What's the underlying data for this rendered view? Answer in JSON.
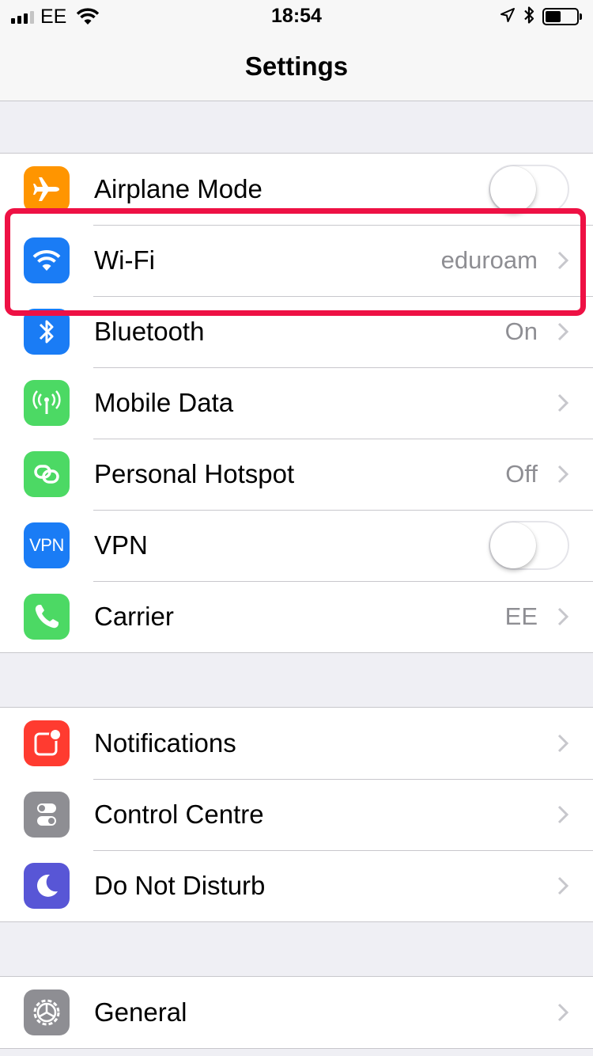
{
  "status_bar": {
    "carrier": "EE",
    "time": "18:54",
    "battery_level": 0.5
  },
  "nav": {
    "title": "Settings"
  },
  "groups": [
    [
      {
        "label": "Airplane Mode",
        "icon": "airplane-icon",
        "color": "#ff9500",
        "accessory": "toggle",
        "on": false
      },
      {
        "label": "Wi-Fi",
        "icon": "wifi-icon",
        "color": "#1a7cf5",
        "accessory": "chevron",
        "value": "eduroam",
        "highlighted": true
      },
      {
        "label": "Bluetooth",
        "icon": "bluetooth-icon",
        "color": "#1a7cf5",
        "accessory": "chevron",
        "value": "On"
      },
      {
        "label": "Mobile Data",
        "icon": "antenna-icon",
        "color": "#4cd964",
        "accessory": "chevron"
      },
      {
        "label": "Personal Hotspot",
        "icon": "hotspot-icon",
        "color": "#4cd964",
        "accessory": "chevron",
        "value": "Off"
      },
      {
        "label": "VPN",
        "icon": "vpn-icon",
        "icon_text": "VPN",
        "color": "#1a7cf5",
        "accessory": "toggle",
        "on": false
      },
      {
        "label": "Carrier",
        "icon": "phone-icon",
        "color": "#4cd964",
        "accessory": "chevron",
        "value": "EE"
      }
    ],
    [
      {
        "label": "Notifications",
        "icon": "notifications-icon",
        "color": "#ff3b30",
        "accessory": "chevron"
      },
      {
        "label": "Control Centre",
        "icon": "control-centre-icon",
        "color": "#8e8e93",
        "accessory": "chevron"
      },
      {
        "label": "Do Not Disturb",
        "icon": "moon-icon",
        "color": "#5856d6",
        "accessory": "chevron"
      }
    ],
    [
      {
        "label": "General",
        "icon": "gear-icon",
        "color": "#8e8e93",
        "accessory": "chevron"
      }
    ]
  ],
  "highlight_color": "#ee1144"
}
